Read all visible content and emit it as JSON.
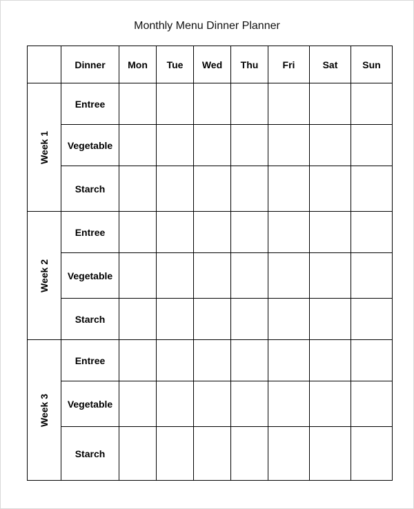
{
  "title": "Monthly Menu Dinner Planner",
  "header": {
    "corner": "",
    "category_label": "Dinner",
    "days": [
      "Mon",
      "Tue",
      "Wed",
      "Thu",
      "Fri",
      "Sat",
      "Sun"
    ]
  },
  "weeks": [
    {
      "label": "Week 1",
      "rows": [
        "Entree",
        "Vegetable",
        "Starch"
      ]
    },
    {
      "label": "Week 2",
      "rows": [
        "Entree",
        "Vegetable",
        "Starch"
      ]
    },
    {
      "label": "Week 3",
      "rows": [
        "Entree",
        "Vegetable",
        "Starch"
      ]
    }
  ],
  "cells": {
    "week1": [
      [
        "",
        "",
        "",
        "",
        "",
        "",
        ""
      ],
      [
        "",
        "",
        "",
        "",
        "",
        "",
        ""
      ],
      [
        "",
        "",
        "",
        "",
        "",
        "",
        ""
      ]
    ],
    "week2": [
      [
        "",
        "",
        "",
        "",
        "",
        "",
        ""
      ],
      [
        "",
        "",
        "",
        "",
        "",
        "",
        ""
      ],
      [
        "",
        "",
        "",
        "",
        "",
        "",
        ""
      ]
    ],
    "week3": [
      [
        "",
        "",
        "",
        "",
        "",
        "",
        ""
      ],
      [
        "",
        "",
        "",
        "",
        "",
        "",
        ""
      ],
      [
        "",
        "",
        "",
        "",
        "",
        "",
        ""
      ]
    ]
  }
}
